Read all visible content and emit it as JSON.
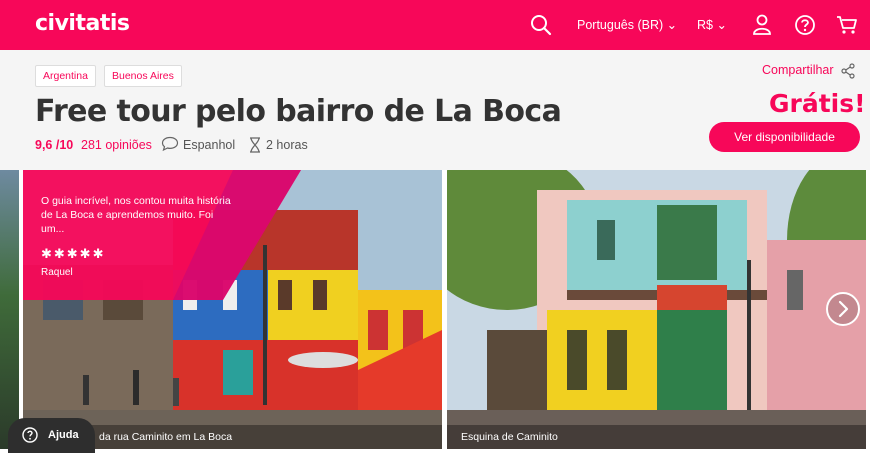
{
  "header": {
    "logo": "civitatis",
    "language": "Português (BR) ⌄",
    "currency": "R$ ⌄",
    "icons": [
      "search-icon",
      "user-icon",
      "help-icon",
      "cart-icon"
    ]
  },
  "breadcrumbs": [
    "Argentina",
    "Buenos Aires"
  ],
  "share_label": "Compartilhar",
  "title": "Free tour pelo bairro de La Boca",
  "price": "Grátis!",
  "cta_label": "Ver disponibilidade",
  "meta": {
    "rating": "9,6 /10",
    "reviews": "281 opiniões",
    "language": "Espanhol",
    "duration": "2 horas"
  },
  "review": {
    "text": "O guia incrível, nos contou muita história de La Boca e aprendemos muito. Foi um...",
    "stars": "✱✱✱✱✱",
    "author": "Raquel"
  },
  "photos": [
    {
      "caption": "da rua Caminito em La Boca"
    },
    {
      "caption": "Esquina de Caminito"
    }
  ],
  "help_label": "Ajuda",
  "colors": {
    "brand": "#f70759",
    "text": "#333333"
  }
}
